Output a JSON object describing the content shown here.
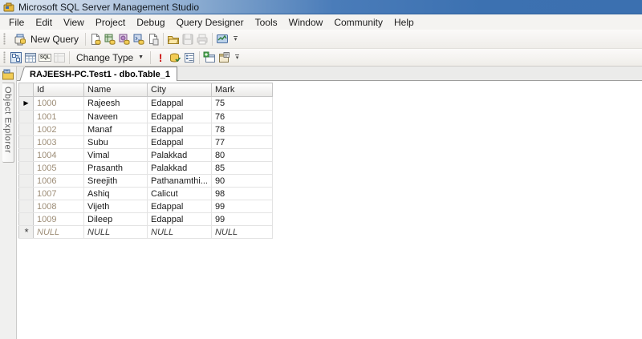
{
  "titlebar": {
    "title": "Microsoft SQL Server Management Studio"
  },
  "menubar": {
    "items": [
      "File",
      "Edit",
      "View",
      "Project",
      "Debug",
      "Query Designer",
      "Tools",
      "Window",
      "Community",
      "Help"
    ]
  },
  "toolbars": {
    "new_query_label": "New Query",
    "change_type_label": "Change Type",
    "execute_glyph": "!",
    "sql_pane_glyph": "SQL",
    "dropdown_caret": "▼",
    "overflow_glyph": "▾"
  },
  "sidebar": {
    "object_explorer_label": "Object Explorer"
  },
  "tabs": {
    "active_tab_title": "RAJEESH-PC.Test1 - dbo.Table_1"
  },
  "grid": {
    "columns": [
      "Id",
      "Name",
      "City",
      "Mark"
    ],
    "rows": [
      [
        "1000",
        "Rajeesh",
        "Edappal",
        "75"
      ],
      [
        "1001",
        "Naveen",
        "Edappal",
        "76"
      ],
      [
        "1002",
        "Manaf",
        "Edappal",
        "78"
      ],
      [
        "1003",
        "Subu",
        "Edappal",
        "77"
      ],
      [
        "1004",
        "Vimal",
        "Palakkad",
        "80"
      ],
      [
        "1005",
        "Prasanth",
        "Palakkad",
        "85"
      ],
      [
        "1006",
        "Sreejith",
        "Pathanamthi...",
        "90"
      ],
      [
        "1007",
        "Ashiq",
        "Calicut",
        "98"
      ],
      [
        "1008",
        "Vijeth",
        "Edappal",
        "99"
      ],
      [
        "1009",
        "Dileep",
        "Edappal",
        "99"
      ]
    ],
    "new_row": [
      "NULL",
      "NULL",
      "NULL",
      "NULL"
    ],
    "current_row_marker": "▶",
    "new_row_marker": "*"
  },
  "colors": {
    "titlebar_blue": "#3c71b1",
    "id_column_text": "#9d8d77",
    "execute_red": "#cc1111",
    "db_yellow": "#f2cc55"
  }
}
